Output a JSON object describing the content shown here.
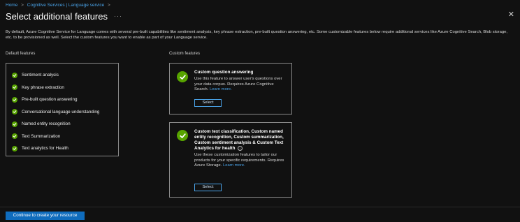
{
  "breadcrumb": {
    "items": [
      "Home",
      "Cognitive Services | Language service"
    ],
    "separator": ">"
  },
  "header": {
    "title": "Select additional features",
    "more_glyph": "···",
    "close_glyph": "✕"
  },
  "description": "By default, Azure Cognitive Service for Language comes with several pre-built capabilities like sentiment analysis, key phrase extraction, pre-built question answering, etc. Some customizable features below require additional services like Azure Cognitive Search, Blob storage, etc. to be provisioned as well. Select the custom features you want to enable as part of your Language service.",
  "default_features": {
    "label": "Default features",
    "items": [
      "Sentiment analysis",
      "Key phrase extraction",
      "Pre-built question answering",
      "Conversational language understanding",
      "Named entity recognition",
      "Text Summarization",
      "Text analytics for Health"
    ]
  },
  "custom_features": {
    "label": "Custom features",
    "cards": [
      {
        "title": "Custom question answering",
        "description": "Use this feature to answer user's questions over your data corpus. Requires Azure Cognitive Search.",
        "link": "Learn more.",
        "button": "Select"
      },
      {
        "title": "Custom text classification, Custom named entity recognition, Custom summarization, Custom sentiment analysis & Custom Text Analytics for health",
        "description": "Use these customization features to tailor our products for your specific requirements. Requires Azure Storage.",
        "link": "Learn more.",
        "button": "Select"
      }
    ]
  },
  "footer": {
    "primary_button": "Continue to create your resource"
  },
  "colors": {
    "background": "#111111",
    "accent_blue": "#0f6cbd",
    "link_blue": "#4aa3e8",
    "success_green": "#57a300",
    "border": "#8a8a8a"
  },
  "icons": {
    "check": "checkmark-circle-icon",
    "info": "info-icon",
    "close": "close-icon",
    "more": "more-icon"
  }
}
